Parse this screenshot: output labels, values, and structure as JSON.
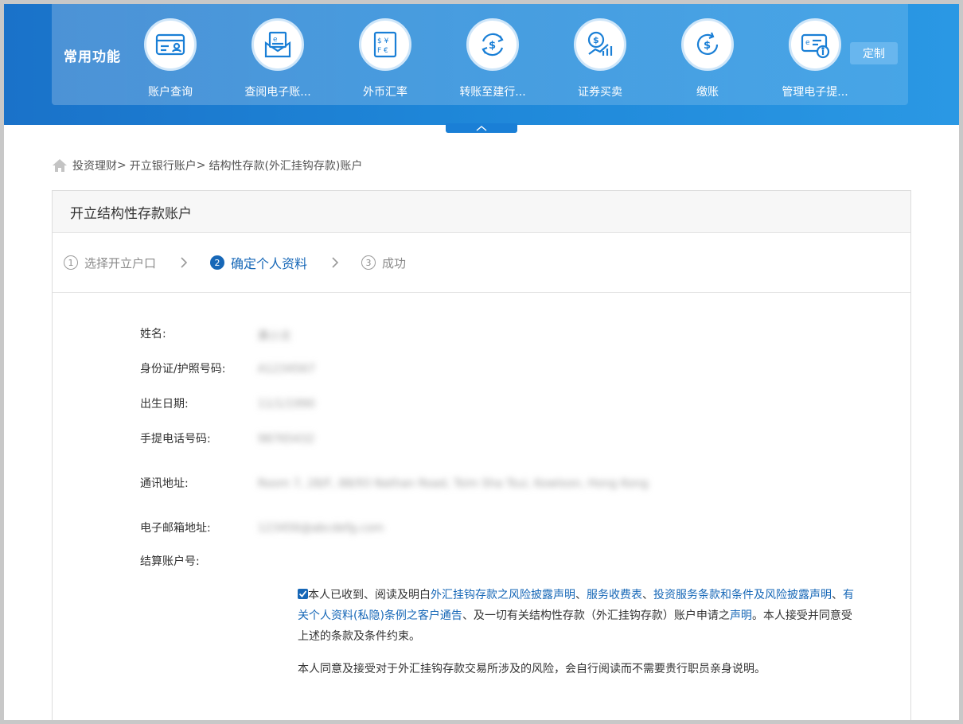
{
  "quick_functions": {
    "title": "常用功能",
    "items": [
      {
        "label": "账户查询",
        "icon": "account-card-icon"
      },
      {
        "label": "查阅电子账...",
        "icon": "e-statement-envelope-icon"
      },
      {
        "label": "外币汇率",
        "icon": "currency-exchange-icon"
      },
      {
        "label": "转账至建行...",
        "icon": "transfer-dollar-icon"
      },
      {
        "label": "证券买卖",
        "icon": "securities-chart-icon"
      },
      {
        "label": "缴账",
        "icon": "bill-payment-icon"
      },
      {
        "label": "管理电子提...",
        "icon": "e-notice-info-icon"
      }
    ],
    "customize_label": "定制"
  },
  "breadcrumb": {
    "items": [
      "投资理财",
      "开立银行账户",
      "结构性存款(外汇挂钩存款)账户"
    ],
    "separator": ">"
  },
  "card": {
    "title": "开立结构性存款账户"
  },
  "steps": [
    {
      "number": "1",
      "label": "选择开立户口",
      "state": "inactive"
    },
    {
      "number": "2",
      "label": "确定个人资料",
      "state": "active"
    },
    {
      "number": "3",
      "label": "成功",
      "state": "inactive"
    }
  ],
  "fields": [
    {
      "label": "姓名:",
      "value": "黄小文"
    },
    {
      "label": "身份证/护照号码:",
      "value": "A1234567"
    },
    {
      "label": "出生日期:",
      "value": "11/1/1990"
    },
    {
      "label": "手提电话号码:",
      "value": "98765432"
    },
    {
      "label": "通讯地址:",
      "value": "Room 7, 28/F, 88/93 Nathan Road, Tsim Sha Tsui, Kowloon, Hong Kong"
    },
    {
      "label": "电子邮箱地址:",
      "value": "123456@abcdefg.com"
    },
    {
      "label": "结算账户号:",
      "value": ""
    }
  ],
  "agreement": {
    "checked": true,
    "part1": "本人已收到、阅读及明白",
    "link1": "外汇挂钩存款之风险披露声明",
    "sep1": "、",
    "link2": "服务收费表",
    "sep2": "、",
    "link3": "投资服务条款和条件及风险披露声明",
    "sep3": "、",
    "link4": "有关个人资料(私隐)条例之客户通告",
    "part2": "、及一切有关结构性存款（外汇挂钩存款）账户申请之",
    "link5": "声明",
    "part3": "。本人接受并同意受上述的条款及条件约束。"
  },
  "risk_statement": "本人同意及接受对于外汇挂钩存款交易所涉及的风险，会自行阅读而不需要贵行职员亲身说明。",
  "colors": {
    "banner_blue": "#1e86d8",
    "active_step": "#1667b7",
    "link": "#1667b7",
    "checkbox": "#1667b7"
  }
}
